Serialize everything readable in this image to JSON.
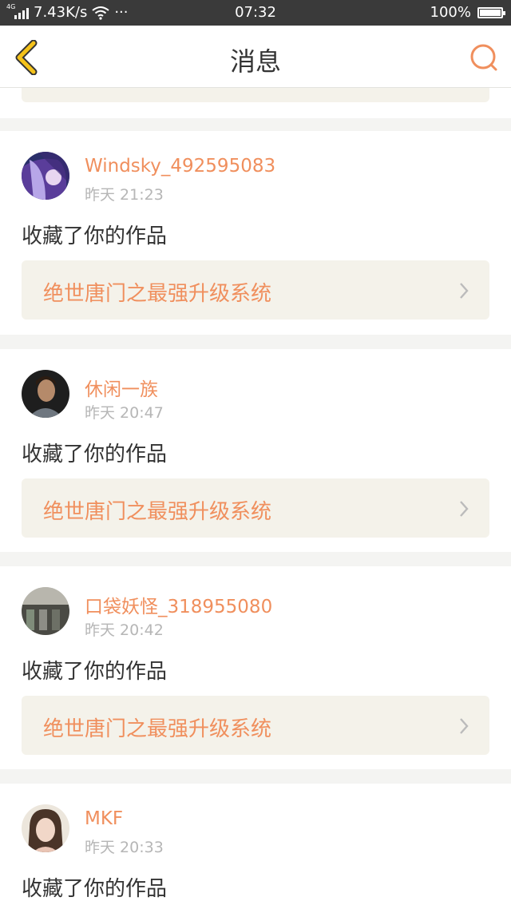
{
  "status_bar": {
    "network": "4G",
    "speed": "7.43K/s",
    "dots": "···",
    "time": "07:32",
    "battery_text": "100%",
    "battery_level": 1.0
  },
  "header": {
    "title": "消息",
    "back_icon": "chevron-left-icon",
    "search_icon": "search-icon"
  },
  "colors": {
    "accent": "#f08f5d",
    "back": "#f4c21a",
    "card_bg": "#f4f2ea"
  },
  "messages": [
    {
      "user": "Windsky_492595083",
      "time": "昨天 21:23",
      "action": "收藏了你的作品",
      "work": "绝世唐门之最强升级系统"
    },
    {
      "user": "休闲一族",
      "time": "昨天 20:47",
      "action": "收藏了你的作品",
      "work": "绝世唐门之最强升级系统"
    },
    {
      "user": "口袋妖怪_318955080",
      "time": "昨天 20:42",
      "action": "收藏了你的作品",
      "work": "绝世唐门之最强升级系统"
    },
    {
      "user": "MKF",
      "time": "昨天 20:33",
      "action": "收藏了你的作品",
      "work": ""
    }
  ]
}
